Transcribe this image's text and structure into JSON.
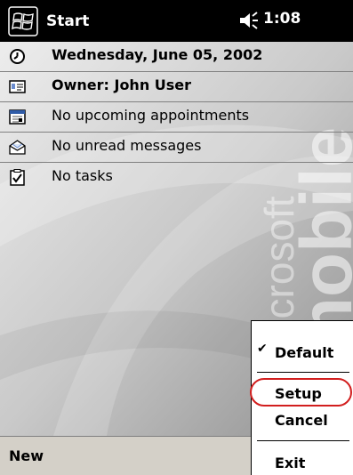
{
  "titlebar": {
    "start_label": "Start",
    "clock": "1:08",
    "start_icon": "windows-flag-icon",
    "volume_icon": "speaker-icon"
  },
  "today": {
    "date": "Wednesday, June 05, 2002",
    "owner": "Owner: John User",
    "appointments": "No upcoming appointments",
    "messages": "No unread messages",
    "tasks": "No tasks",
    "icons": [
      "clock-icon",
      "owner-card-icon",
      "calendar-icon",
      "envelope-icon",
      "checkbox-icon"
    ]
  },
  "background": {
    "brand_text_1": "Microsoft",
    "brand_text_2": "mobile"
  },
  "menu": {
    "items": [
      {
        "label": "Default",
        "checked": true
      },
      {
        "label": "Setup",
        "highlighted": true
      },
      {
        "label": "Cancel"
      },
      {
        "label": "Exit"
      }
    ],
    "check_mark": "✔",
    "highlight_color": "#d21e1e"
  },
  "cmdbar": {
    "new_label": "New"
  }
}
